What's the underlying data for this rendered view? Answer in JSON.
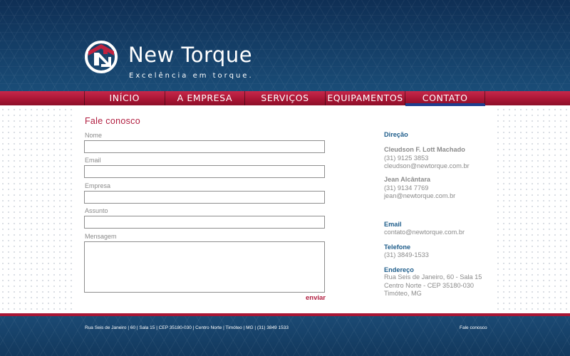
{
  "brand": {
    "name": "New Torque",
    "tagline": "Excelência em torque."
  },
  "nav": {
    "items": [
      "INÍCIO",
      "A EMPRESA",
      "SERVIÇOS",
      "EQUIPAMENTOS",
      "CONTATO"
    ],
    "active": "CONTATO"
  },
  "form": {
    "title": "Fale conosco",
    "fields": {
      "name_label": "Nome",
      "email_label": "Email",
      "company_label": "Empresa",
      "subject_label": "Assunto",
      "message_label": "Mensagem"
    },
    "send_label": "enviar"
  },
  "contact": {
    "management_heading": "Direção",
    "people": [
      {
        "name": "Cleudson F. Lott Machado",
        "phone": "(31) 9125 3853",
        "email": "cleudson@newtorque.com.br"
      },
      {
        "name": "Jean Alcântara",
        "phone": "(31) 9134 7769",
        "email": "jean@newtorque.com.br"
      }
    ],
    "email_heading": "Email",
    "email": "contato@newtorque.com.br",
    "phone_heading": "Telefone",
    "phone": "(31) 3849-1533",
    "address_heading": "Endereço",
    "address_lines": [
      "Rua Seis de Janeiro, 60 - Sala 15",
      "Centro Norte - CEP 35180-030",
      "Timóteo, MG"
    ]
  },
  "footer": {
    "address": "Rua Seis de Janeiro  |  60  |  Sala 15  |  CEP 35180-030  |  Centro Norte  |  Timóteo  |  MG  |  (31) 3849 1533",
    "link": "Fale conosco"
  },
  "colors": {
    "header_blue": "#16446a",
    "nav_red": "#a81534",
    "title_red": "#b11d3f",
    "heading_blue": "#1d5c8a"
  }
}
